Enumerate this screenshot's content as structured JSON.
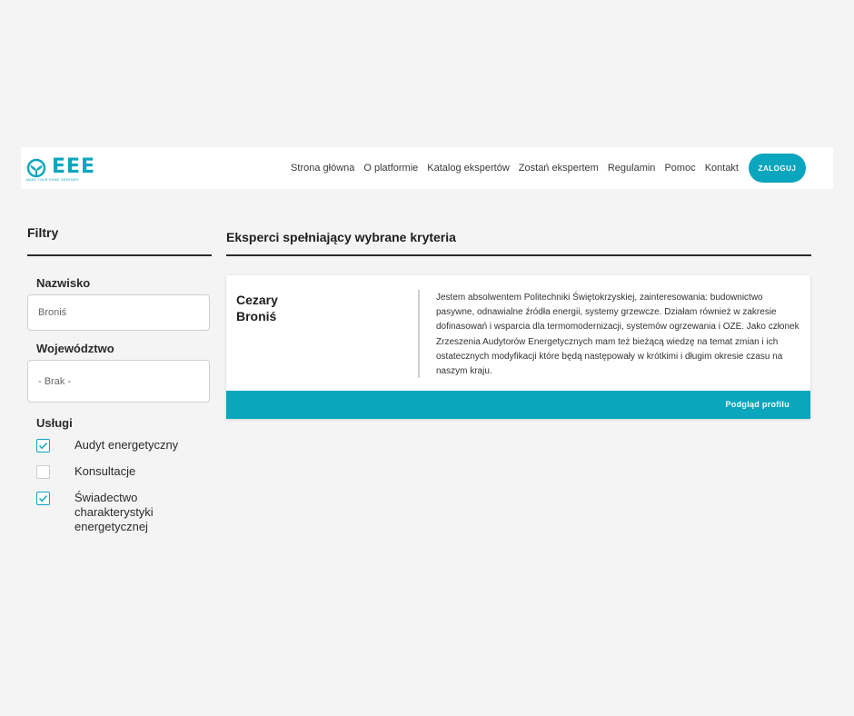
{
  "brand": {
    "name": "EEE",
    "tagline": "MAKE YOUR HOME GREENER",
    "accent_color": "#0aa6be",
    "logo_icon": "leaf-circle-icon"
  },
  "nav": {
    "links": [
      "Strona główna",
      "O platformie",
      "Katalog ekspertów",
      "Zostań ekspertem",
      "Regulamin",
      "Pomoc",
      "Kontakt"
    ],
    "login_label": "ZALOGUJ"
  },
  "filters": {
    "title": "Filtry",
    "surname_label": "Nazwisko",
    "surname_value": "Broniś",
    "voivodeship_label": "Województwo",
    "voivodeship_value": "- Brak -",
    "services_label": "Usługi",
    "services": [
      {
        "label": "Audyt energetyczny",
        "checked": true
      },
      {
        "label": "Konsultacje",
        "checked": false
      },
      {
        "label": "Świadectwo charakterystyki energetycznej",
        "checked": true
      }
    ]
  },
  "results": {
    "title": "Eksperci spełniający wybrane kryteria",
    "experts": [
      {
        "first_name": "Cezary",
        "last_name": "Broniś",
        "description": "Jestem absolwentem Politechniki Świętokrzyskiej, zainteresowania: budownictwo pasywne, odnawialne źródła energii, systemy grzewcze. Działam również w zakresie dofinasowań i wsparcia dla termomodernizacji, systemów ogrzewania i OZE. Jako członek Zrzeszenia Audytorów Energetycznych mam też bieżącą wiedzę na temat zmian i ich ostatecznych modyfikacji które będą następowały w krótkimi i długim okresie czasu na naszym kraju.",
        "profile_link": "Podgląd profilu"
      }
    ]
  }
}
